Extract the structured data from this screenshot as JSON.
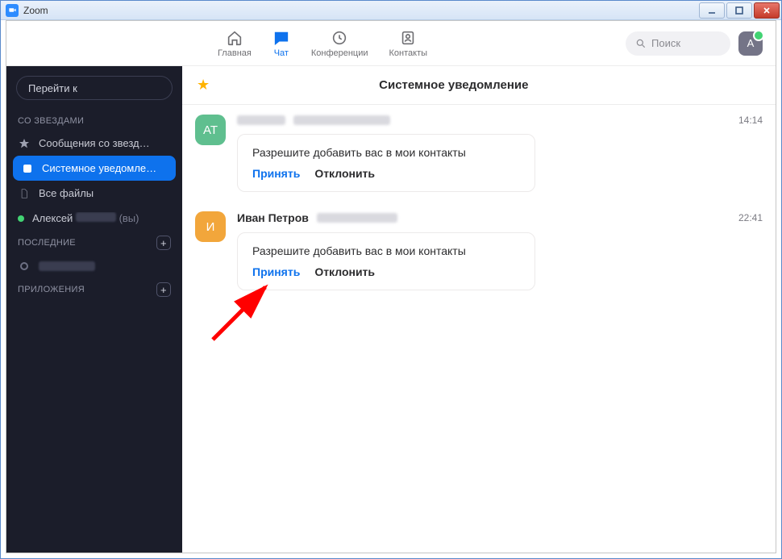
{
  "window": {
    "title": "Zoom"
  },
  "nav": {
    "home": "Главная",
    "chat": "Чат",
    "meetings": "Конференции",
    "contacts": "Контакты"
  },
  "search": {
    "placeholder": "Поиск"
  },
  "avatar": {
    "initial": "A"
  },
  "sidebar": {
    "jump": "Перейти к",
    "sections": {
      "starred": "СО ЗВЕЗДАМИ",
      "recent": "ПОСЛЕДНИЕ",
      "apps": "ПРИЛОЖЕНИЯ"
    },
    "items": {
      "starredMessages": "Сообщения со звезд…",
      "systemNotif": "Системное уведомле…",
      "allFiles": "Все файлы",
      "selfName": "Алексей",
      "selfSuffix": "(вы)"
    }
  },
  "main": {
    "title": "Системное уведомление"
  },
  "messages": [
    {
      "initials": "АТ",
      "name": "",
      "time": "14:14",
      "request": "Разрешите добавить вас в мои контакты",
      "accept": "Принять",
      "decline": "Отклонить"
    },
    {
      "initials": "И",
      "name": "Иван Петров",
      "time": "22:41",
      "request": "Разрешите добавить вас в мои контакты",
      "accept": "Принять",
      "decline": "Отклонить"
    }
  ]
}
